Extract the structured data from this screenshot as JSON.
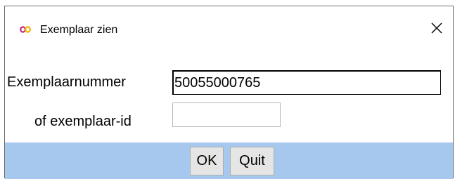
{
  "window": {
    "title": "Exemplaar zien",
    "app_icon": "infinity-logo-icon",
    "close_icon": "close-icon"
  },
  "form": {
    "exemplaarnummer_label": "Exemplaarnummer",
    "exemplaarnummer_value": "50055000765",
    "exemplaar_id_label": "of exemplaar-id",
    "exemplaar_id_value": ""
  },
  "buttons": {
    "ok_label": "OK",
    "quit_label": "Quit"
  },
  "colors": {
    "button_bar": "#a6c8ef",
    "app_icon_primary": "#c62a8a",
    "app_icon_secondary": "#f2b300"
  }
}
